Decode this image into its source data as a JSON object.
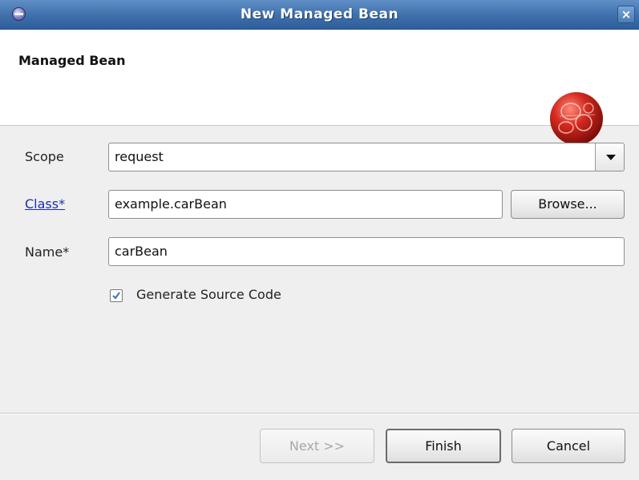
{
  "window": {
    "title": "New Managed Bean",
    "close_glyph": "×",
    "app_icon": "eclipse-icon"
  },
  "banner": {
    "title": "Managed Bean",
    "logo_icon": "faces-config-logo"
  },
  "form": {
    "scope": {
      "label": "Scope",
      "value": "request"
    },
    "class": {
      "label": "Class*",
      "value": "example.carBean",
      "browse_label": "Browse..."
    },
    "name": {
      "label": "Name*",
      "value": "carBean"
    },
    "generate": {
      "label": "Generate Source Code",
      "checked": true
    }
  },
  "buttons": {
    "next": "Next >>",
    "finish": "Finish",
    "cancel": "Cancel"
  },
  "colors": {
    "titlebar": "#3f6faa",
    "link": "#1a2fb0",
    "logo_red": "#d42a20",
    "check_blue": "#3b6fb6"
  }
}
